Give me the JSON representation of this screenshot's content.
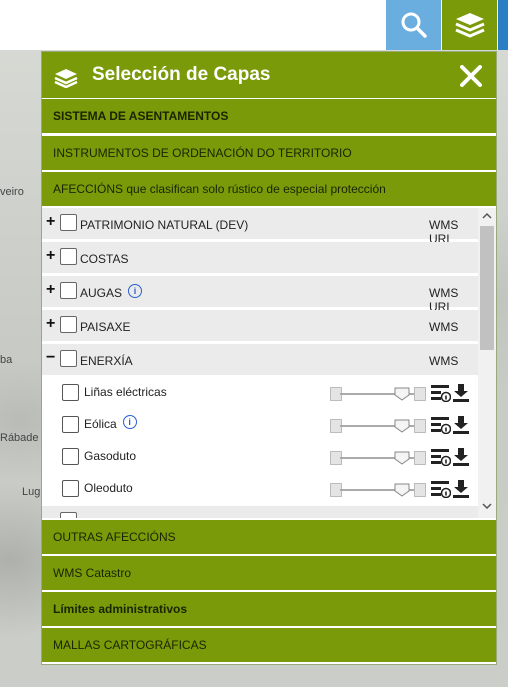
{
  "map": {
    "labels": [
      "veiro",
      "ba",
      "Rábade",
      "Lug"
    ]
  },
  "top_buttons": {
    "search_icon": "search-icon",
    "layers_icon": "layers-icon"
  },
  "panel": {
    "title": "Selección de Capas",
    "sections_top": [
      {
        "label": "SISTEMA DE ASENTAMENTOS",
        "bold": true
      },
      {
        "label": "INSTRUMENTOS DE ORDENACIÓN DO TERRITORIO",
        "bold": false
      },
      {
        "label": "AFECCIÓNS que clasifican solo rústico de especial protección",
        "bold": false
      }
    ],
    "rows": [
      {
        "expander": "+",
        "label": "PATRIMONIO NATURAL (DEV)",
        "service": "WMS URL",
        "info": false
      },
      {
        "expander": "+",
        "label": "COSTAS",
        "service": "",
        "info": false
      },
      {
        "expander": "+",
        "label": "AUGAS",
        "service": "WMS URL",
        "info": true
      },
      {
        "expander": "+",
        "label": "PAISAXE",
        "service": "WMS",
        "info": false
      },
      {
        "expander": "−",
        "label": "ENERXÍA",
        "service": "WMS",
        "info": false
      }
    ],
    "sublayers": [
      {
        "label": "Liñas eléctricas",
        "info": false
      },
      {
        "label": "Eólica",
        "info": true
      },
      {
        "label": "Gasoduto",
        "info": false
      },
      {
        "label": "Oleoduto",
        "info": false
      }
    ],
    "sections_bottom": [
      {
        "label": "OUTRAS AFECCIÓNS",
        "bold": false
      },
      {
        "label": "WMS Catastro",
        "bold": false
      },
      {
        "label": "Límites administrativos",
        "bold": true
      },
      {
        "label": "MALLAS CARTOGRÁFICAS",
        "bold": false
      }
    ]
  },
  "colors": {
    "accent_green": "#7a9a0a",
    "search_blue": "#6aaee0",
    "info_blue": "#2a5fd0"
  }
}
